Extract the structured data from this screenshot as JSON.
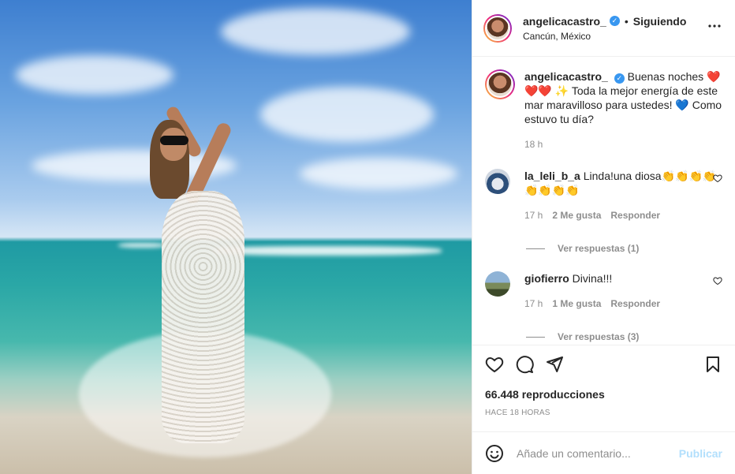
{
  "header": {
    "username": "angelicacastro_",
    "verified_mark": "✓",
    "separator": "•",
    "following_label": "Siguiendo",
    "location": "Cancún, México",
    "more_icon": "more-icon"
  },
  "caption": {
    "username": "angelicacastro_",
    "text": "Buenas noches ❤️❤️❤️ ✨ Toda la mejor energía de este mar maravilloso para ustedes! 💙 Como estuvo tu día?",
    "time": "18 h"
  },
  "comments": [
    {
      "username": "la_leli_b_a",
      "text": "Linda!una diosa👏👏👏👏👏👏👏👏",
      "time": "17 h",
      "likes": "2 Me gusta",
      "reply_label": "Responder",
      "replies_label": "Ver respuestas (1)"
    },
    {
      "username": "giofierro",
      "text": "Divina!!!",
      "time": "17 h",
      "likes": "1 Me gusta",
      "reply_label": "Responder",
      "replies_label": "Ver respuestas (3)"
    }
  ],
  "stats": {
    "views": "66.448 reproducciones",
    "posted_ago": "HACE 18 HORAS"
  },
  "add_comment": {
    "placeholder": "Añade un comentario...",
    "publish_label": "Publicar"
  },
  "colors": {
    "verified": "#3897f0",
    "publish_disabled": "#b2dffc",
    "muted_text": "#8e8e8e"
  }
}
